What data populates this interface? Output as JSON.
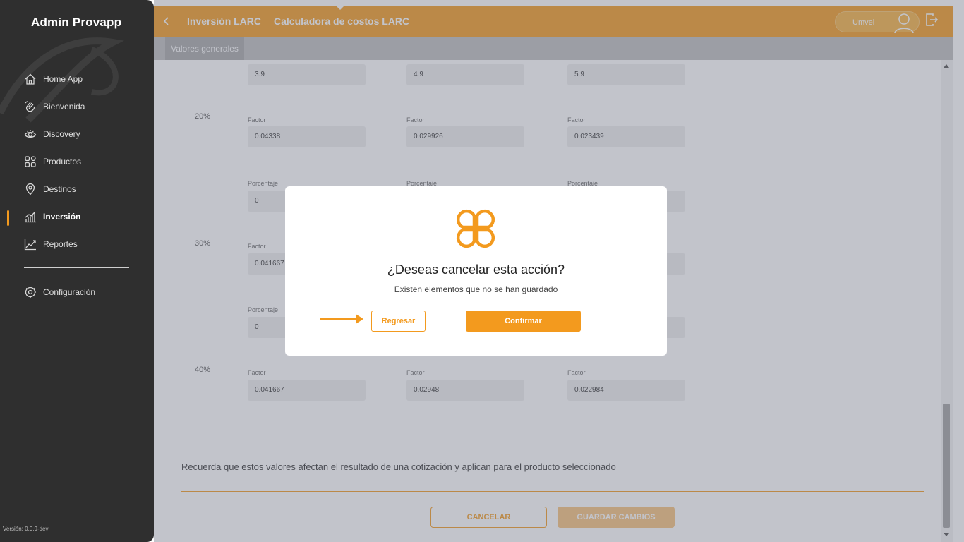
{
  "sidebar": {
    "brand": "Admin Provapp",
    "items": [
      {
        "label": "Home App",
        "icon": "home-icon"
      },
      {
        "label": "Bienvenida",
        "icon": "wave-hand-icon"
      },
      {
        "label": "Discovery",
        "icon": "eye-icon"
      },
      {
        "label": "Productos",
        "icon": "grid-icon"
      },
      {
        "label": "Destinos",
        "icon": "location-pin-icon"
      },
      {
        "label": "Inversión",
        "icon": "bar-chart-icon",
        "active": true
      },
      {
        "label": "Reportes",
        "icon": "trend-chart-icon"
      }
    ],
    "settings_label": "Configuración",
    "version": "Versión: 0.0.9-dev"
  },
  "header": {
    "breadcrumb_1": "Inversión LARC",
    "breadcrumb_2": "Calculadora de costos LARC",
    "user_name": "Umvel",
    "accent_color": "#f39a1e"
  },
  "tabs": {
    "active": "Valores generales"
  },
  "form": {
    "top_values": [
      "3.9",
      "4.9",
      "5.9"
    ],
    "groups": [
      {
        "percent": "20%",
        "factor_label": "Factor",
        "factors": [
          "0.04338",
          "0.029926",
          "0.023439"
        ]
      },
      {
        "percent": "30%",
        "porcentaje_label": "Porcentaje",
        "porcentaje_labels": [
          "Porcentaje",
          "Porcentaje",
          "Porcentaje"
        ],
        "porcentaje_first": "0",
        "factor_label": "Factor",
        "factor_first": "0.041667"
      },
      {
        "percent": "40%",
        "porcentaje_label": "Porcentaje",
        "porcentaje_first": "0",
        "factor_label": "Factor",
        "factors": [
          "0.041667",
          "0.02948",
          "0.022984"
        ]
      }
    ],
    "note": "Recuerda que estos valores afectan el resultado de una cotización y aplican para el producto seleccionado",
    "cancel_label": "CANCELAR",
    "save_label": "GUARDAR CAMBIOS"
  },
  "modal": {
    "title": "¿Deseas cancelar esta acción?",
    "subtitle": "Existen elementos que no se han guardado",
    "back_label": "Regresar",
    "confirm_label": "Confirmar"
  }
}
